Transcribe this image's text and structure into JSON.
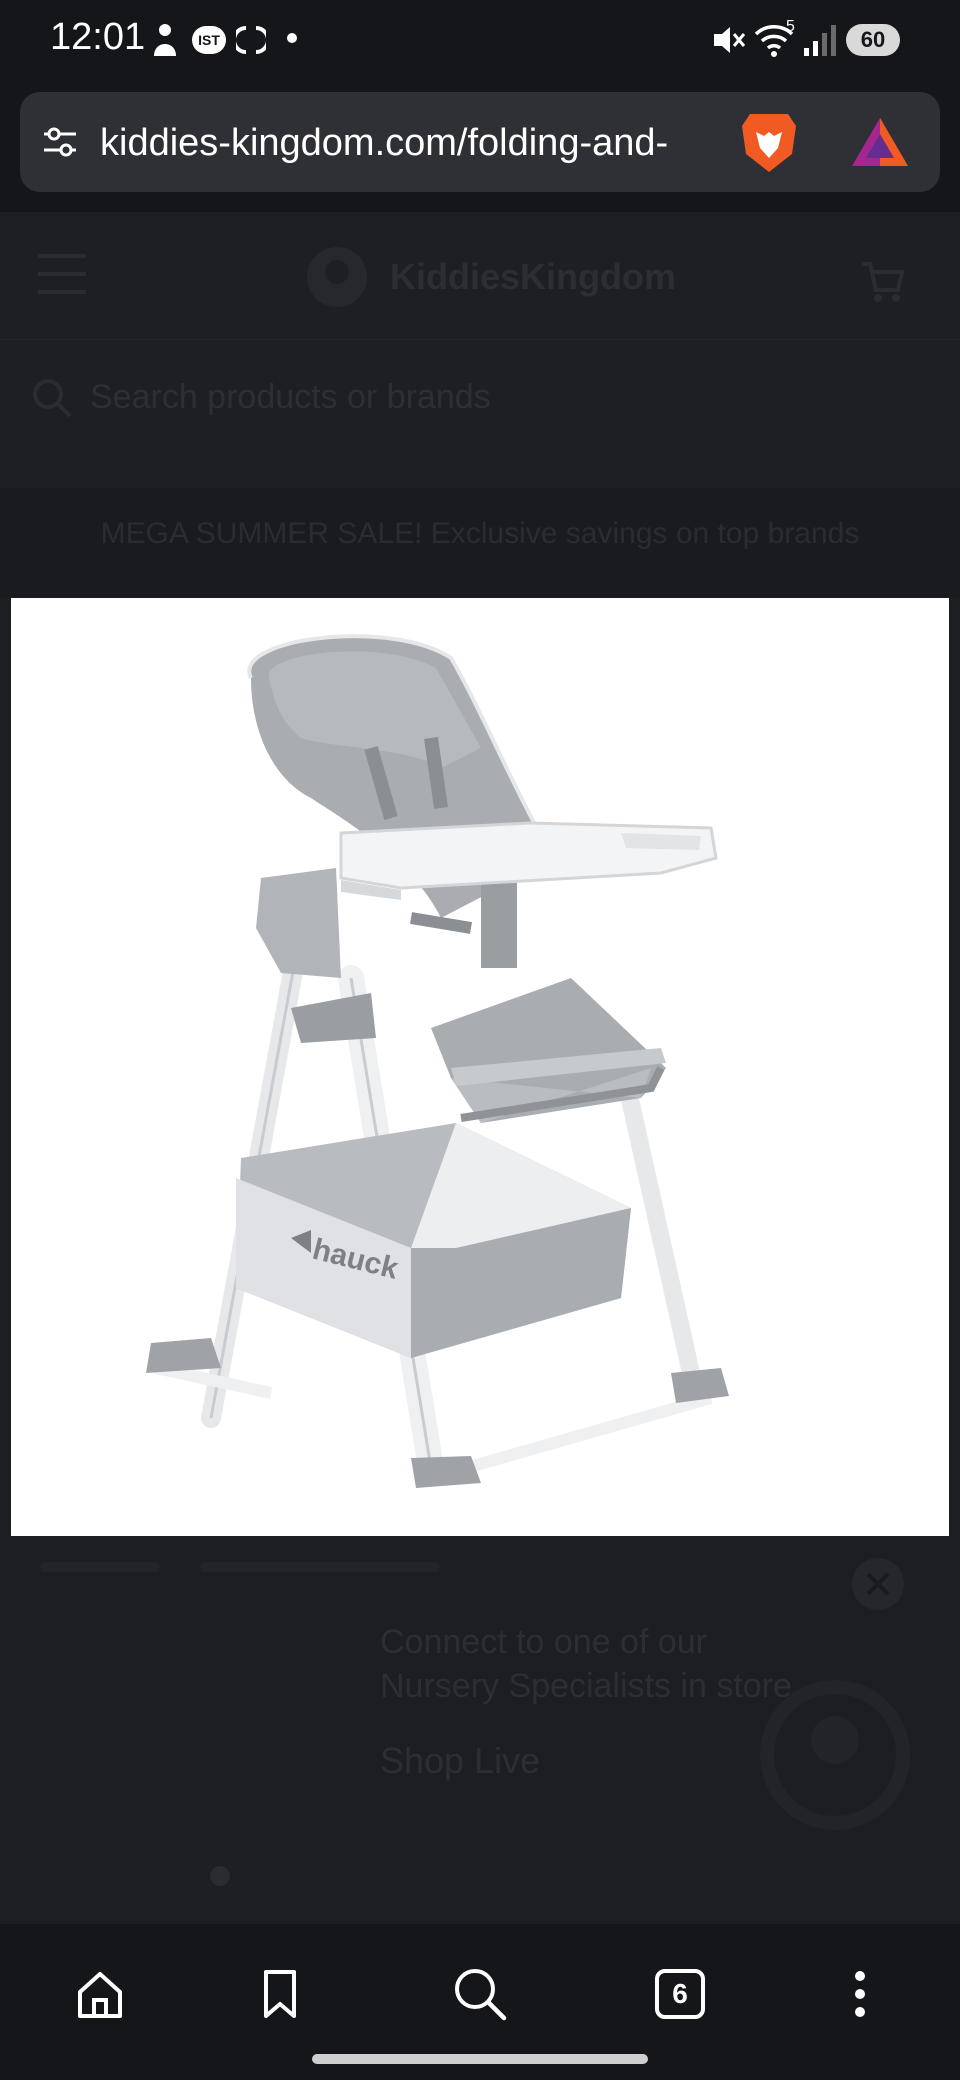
{
  "status_bar": {
    "time": "12:01",
    "network_badge": "IST",
    "wifi_badge": "5",
    "battery": "60",
    "icons": [
      "person-icon",
      "ist-icon",
      "sync-icon",
      "dot-icon",
      "mute-icon",
      "wifi-icon",
      "signal-icon",
      "battery-icon"
    ]
  },
  "browser": {
    "url": "kiddies-kingdom.com/folding-and-",
    "icons": [
      "site-settings-icon",
      "brave-lion-icon",
      "brave-rewards-icon"
    ]
  },
  "page": {
    "site_name": "KiddiesKingdom",
    "search_placeholder": "Search products or brands",
    "promo_text": "MEGA SUMMER SALE! Exclusive savings on top brands",
    "product_image": {
      "alt": "Grey highchair with tray and under-seat basket",
      "brand_on_basket": "hauck"
    },
    "chat": {
      "text_line1": "Connect to one of our",
      "text_line2": "Nursery Specialists in store",
      "cta": "Shop Live"
    }
  },
  "bottom_nav": {
    "tab_count": "6",
    "icons": [
      "home-icon",
      "bookmark-icon",
      "search-icon",
      "tabs-icon",
      "more-icon"
    ]
  },
  "colors": {
    "background": "#151619",
    "address_bar": "#2f3035",
    "overlay_page": "#1d1e22",
    "brave_orange": "#f15a22",
    "chair_grey": "#a9adb1"
  }
}
